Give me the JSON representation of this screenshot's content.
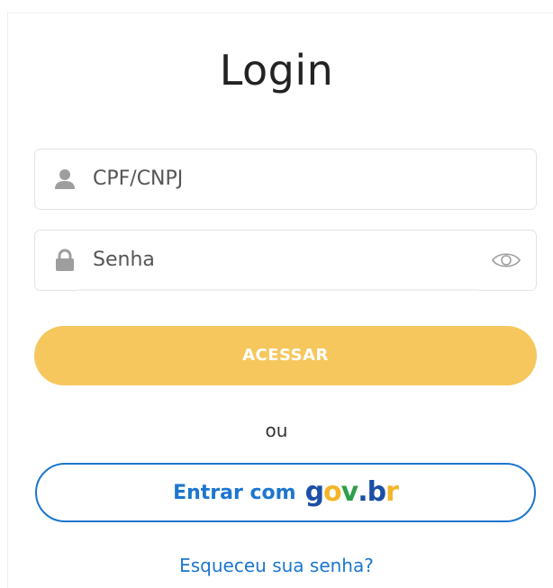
{
  "login": {
    "title": "Login",
    "cpf_placeholder": "CPF/CNPJ",
    "password_placeholder": "Senha",
    "submit_label": "ACESSAR",
    "separator": "ou",
    "gov_button_label": "Entrar com",
    "gov_logo": {
      "letters": [
        {
          "char": "g",
          "color": "#1c4fa6"
        },
        {
          "char": "o",
          "color": "#f3b526"
        },
        {
          "char": "v",
          "color": "#2e9f4a"
        },
        {
          "char": ".",
          "color": "#1c4fa6"
        },
        {
          "char": "b",
          "color": "#1c4fa6"
        },
        {
          "char": "r",
          "color": "#f3b526"
        }
      ]
    },
    "forgot_label": "Esqueceu sua senha?"
  },
  "colors": {
    "accent_yellow": "#f6c75c",
    "link_blue": "#1c76cf",
    "icon_gray": "#9e9e9e"
  },
  "icons": {
    "user": "user-icon",
    "lock": "lock-icon",
    "eye": "eye-icon"
  }
}
